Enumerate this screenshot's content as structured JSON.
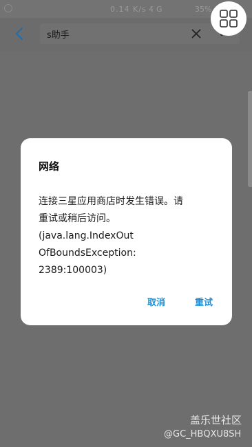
{
  "status_bar": {
    "net_speed": "0.14 K/s",
    "network": "4G",
    "battery": "35%"
  },
  "header": {
    "search_text": "s助手"
  },
  "dialog": {
    "title": "网络",
    "message": "连接三星应用商店时发生错误。请\n重试或稍后访问。\n(java.lang.IndexOut\nOfBoundsException:\n2389:100003)",
    "cancel_label": "取消",
    "retry_label": "重试"
  },
  "watermark": {
    "logo": "盖乐世社区",
    "user": "@GC_HBQXU8SH"
  },
  "colors": {
    "accent": "#1f8fd6",
    "scrim": "#6e6e6e"
  }
}
